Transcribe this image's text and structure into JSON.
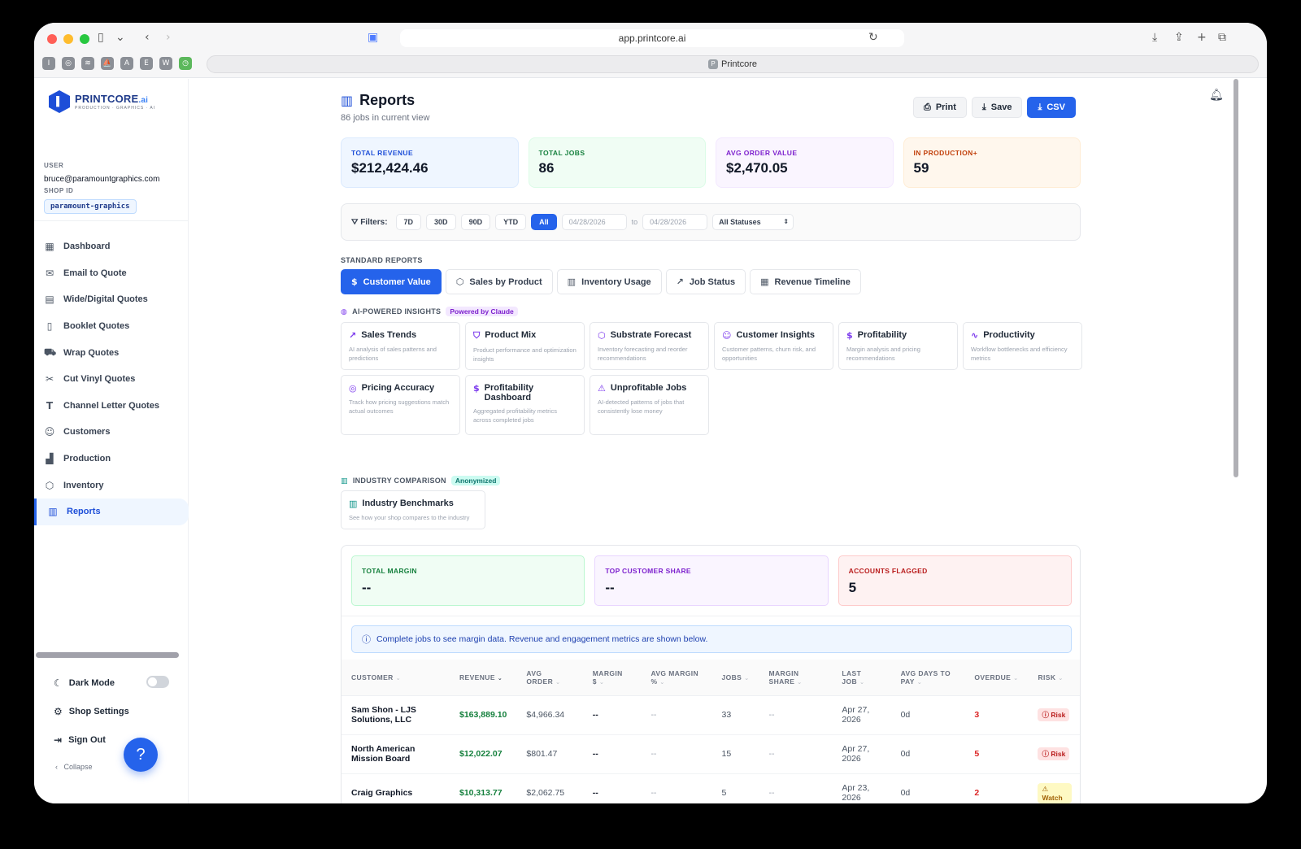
{
  "browser": {
    "url": "app.printcore.ai",
    "tab_title": "Printcore",
    "bookmarks": [
      "I",
      "◎",
      "≋",
      "⛵",
      "A",
      "E",
      "W",
      "◷"
    ]
  },
  "sidebar": {
    "logo_text": "PRINTCORE",
    "logo_ai": ".ai",
    "logo_tagline": "PRODUCTION · GRAPHICS · AI",
    "user_label": "USER",
    "user_email": "bruce@paramountgraphics.com",
    "shop_label": "SHOP ID",
    "shop_id": "paramount-graphics",
    "items": [
      {
        "label": "Dashboard",
        "icon": "▦"
      },
      {
        "label": "Email to Quote",
        "icon": "✉"
      },
      {
        "label": "Wide/Digital Quotes",
        "icon": "▤"
      },
      {
        "label": "Booklet Quotes",
        "icon": "▯"
      },
      {
        "label": "Wrap Quotes",
        "icon": "⛟"
      },
      {
        "label": "Cut Vinyl Quotes",
        "icon": "✂"
      },
      {
        "label": "Channel Letter Quotes",
        "icon": "T"
      },
      {
        "label": "Customers",
        "icon": "☺"
      },
      {
        "label": "Production",
        "icon": "▟"
      },
      {
        "label": "Inventory",
        "icon": "⬡"
      },
      {
        "label": "Reports",
        "icon": "▥"
      }
    ],
    "dark_mode": "Dark Mode",
    "shop_settings": "Shop Settings",
    "sign_out": "Sign Out",
    "collapse": "Collapse"
  },
  "header": {
    "title": "Reports",
    "subtitle": "86 jobs in current view",
    "print": "Print",
    "save": "Save",
    "csv": "CSV"
  },
  "stats": [
    {
      "label": "TOTAL REVENUE",
      "value": "$212,424.46",
      "color": "#1d4ed8",
      "bg": "#eff6ff",
      "border": "#dbeafe"
    },
    {
      "label": "TOTAL JOBS",
      "value": "86",
      "color": "#15803d",
      "bg": "#f0fdf4",
      "border": "#dcfce7"
    },
    {
      "label": "AVG ORDER VALUE",
      "value": "$2,470.05",
      "color": "#7e22ce",
      "bg": "#faf5ff",
      "border": "#f3e8ff"
    },
    {
      "label": "IN PRODUCTION+",
      "value": "59",
      "color": "#c2410c",
      "bg": "#fff7ed",
      "border": "#ffedd5"
    }
  ],
  "filters": {
    "label": "Filters:",
    "ranges": [
      "7D",
      "30D",
      "90D",
      "YTD",
      "All"
    ],
    "active_range": "All",
    "date_from": "04/28/2026",
    "to": "to",
    "date_to": "04/28/2026",
    "status": "All Statuses"
  },
  "standard_reports": {
    "label": "STANDARD REPORTS",
    "tabs": [
      {
        "label": "Customer Value",
        "icon": "$"
      },
      {
        "label": "Sales by Product",
        "icon": "⬡"
      },
      {
        "label": "Inventory Usage",
        "icon": "▥"
      },
      {
        "label": "Job Status",
        "icon": "↗"
      },
      {
        "label": "Revenue Timeline",
        "icon": "▦"
      }
    ]
  },
  "ai_insights": {
    "label": "AI-POWERED INSIGHTS",
    "tag": "Powered by Claude",
    "cards": [
      {
        "title": "Sales Trends",
        "desc": "AI analysis of sales patterns and predictions",
        "icon": "↗"
      },
      {
        "title": "Product Mix",
        "desc": "Product performance and optimization insights",
        "icon": "⛉"
      },
      {
        "title": "Substrate Forecast",
        "desc": "Inventory forecasting and reorder recommendations",
        "icon": "⬡"
      },
      {
        "title": "Customer Insights",
        "desc": "Customer patterns, churn risk, and opportunities",
        "icon": "☺"
      },
      {
        "title": "Profitability",
        "desc": "Margin analysis and pricing recommendations",
        "icon": "$"
      },
      {
        "title": "Productivity",
        "desc": "Workflow bottlenecks and efficiency metrics",
        "icon": "∿"
      },
      {
        "title": "Pricing Accuracy",
        "desc": "Track how pricing suggestions match actual outcomes",
        "icon": "◎"
      },
      {
        "title": "Profitability Dashboard",
        "desc": "Aggregated profitability metrics across completed jobs",
        "icon": "$"
      },
      {
        "title": "Unprofitable Jobs",
        "desc": "AI-detected patterns of jobs that consistently lose money",
        "icon": "⚠"
      }
    ]
  },
  "industry": {
    "label": "INDUSTRY COMPARISON",
    "tag": "Anonymized",
    "card_title": "Industry Benchmarks",
    "card_desc": "See how your shop compares to the industry",
    "icon": "▥"
  },
  "customer_value": {
    "metrics": [
      {
        "label": "TOTAL MARGIN",
        "value": "--",
        "color": "#15803d",
        "bg": "#f0fdf4",
        "border": "#bbf7d0"
      },
      {
        "label": "TOP CUSTOMER SHARE",
        "value": "--",
        "color": "#7e22ce",
        "bg": "#faf5ff",
        "border": "#e9d5ff"
      },
      {
        "label": "ACCOUNTS FLAGGED",
        "value": "5",
        "color": "#b91c1c",
        "bg": "#fef2f2",
        "border": "#fecaca"
      }
    ],
    "notice": "Complete jobs to see margin data. Revenue and engagement metrics are shown below.",
    "columns": [
      "CUSTOMER",
      "REVENUE",
      "AVG ORDER",
      "MARGIN $",
      "AVG MARGIN %",
      "JOBS",
      "MARGIN SHARE",
      "LAST JOB",
      "AVG DAYS TO PAY",
      "OVERDUE",
      "RISK"
    ],
    "rows": [
      {
        "customer": "Sam Shon - LJS Solutions, LLC",
        "revenue": "$163,889.10",
        "avg_order": "$4,966.34",
        "margin": "--",
        "avg_margin": "--",
        "jobs": "33",
        "share": "--",
        "last_job": "Apr 27, 2026",
        "days_to_pay": "0d",
        "overdue": "3",
        "risk": "Risk",
        "risk_type": "r",
        "risk_icon": "ⓘ"
      },
      {
        "customer": "North American Mission Board",
        "revenue": "$12,022.07",
        "avg_order": "$801.47",
        "margin": "--",
        "avg_margin": "--",
        "jobs": "15",
        "share": "--",
        "last_job": "Apr 27, 2026",
        "days_to_pay": "0d",
        "overdue": "5",
        "risk": "Risk",
        "risk_type": "r",
        "risk_icon": "ⓘ"
      },
      {
        "customer": "Craig Graphics",
        "revenue": "$10,313.77",
        "avg_order": "$2,062.75",
        "margin": "--",
        "avg_margin": "--",
        "jobs": "5",
        "share": "--",
        "last_job": "Apr 23, 2026",
        "days_to_pay": "0d",
        "overdue": "2",
        "risk": "Watch",
        "risk_type": "w",
        "risk_icon": "⚠"
      }
    ]
  }
}
